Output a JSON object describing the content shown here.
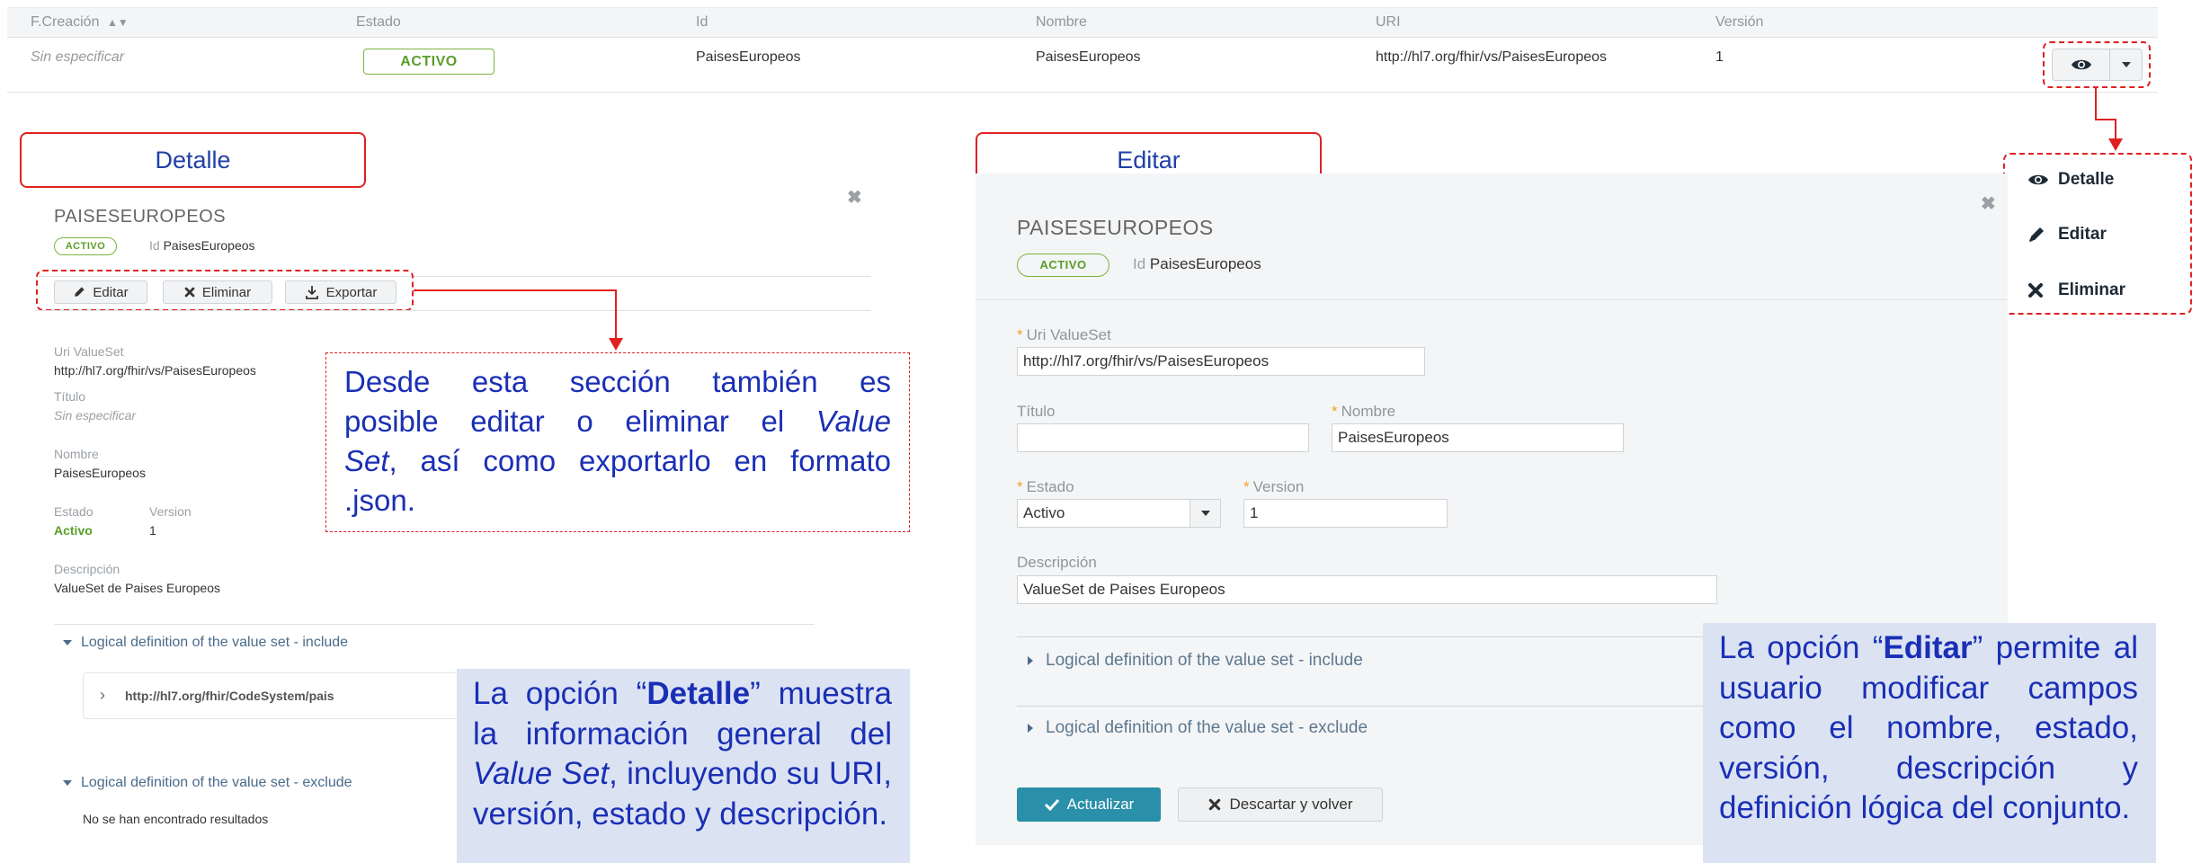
{
  "table": {
    "headers": {
      "fecha": "F.Creación",
      "fecha_sort_icon": "sort-icon",
      "estado": "Estado",
      "id": "Id",
      "nombre": "Nombre",
      "uri": "URI",
      "version": "Versión"
    },
    "row": {
      "fecha": "Sin especificar",
      "estado": "ACTIVO",
      "id": "PaisesEuropeos",
      "nombre": "PaisesEuropeos",
      "uri": "http://hl7.org/fhir/vs/PaisesEuropeos",
      "version": "1"
    },
    "actions": {
      "view_icon": "eye-icon",
      "caret_icon": "caret-down-icon"
    }
  },
  "dropdown_menu": {
    "items": [
      {
        "label": "Detalle",
        "icon": "eye-icon"
      },
      {
        "label": "Editar",
        "icon": "pencil-icon"
      },
      {
        "label": "Eliminar",
        "icon": "close-icon"
      }
    ]
  },
  "labels": {
    "detalle_title": "Detalle",
    "editar_title": "Editar"
  },
  "detail_panel": {
    "title": "PAISESEUROPEOS",
    "badge": "ACTIVO",
    "id_label": "Id",
    "id_value": "PaisesEuropeos",
    "buttons": {
      "editar": "Editar",
      "eliminar": "Eliminar",
      "exportar": "Exportar"
    },
    "uri_label": "Uri ValueSet",
    "uri_value": "http://hl7.org/fhir/vs/PaisesEuropeos",
    "titulo_label": "Título",
    "titulo_value": "Sin especificar",
    "nombre_label": "Nombre",
    "nombre_value": "PaisesEuropeos",
    "estado_label": "Estado",
    "estado_value": "Activo",
    "version_label": "Version",
    "version_value": "1",
    "descripcion_label": "Descripción",
    "descripcion_value": "ValueSet de Paises Europeos",
    "include_section": "Logical definition of the value set - include",
    "include_item": "http://hl7.org/fhir/CodeSystem/pais",
    "exclude_section": "Logical definition of the value set - exclude",
    "exclude_empty": "No se han encontrado resultados"
  },
  "callouts": {
    "section": {
      "line1": "Desde esta sección también es",
      "line2": "posible editar o eliminar el ",
      "line2_em": "Value",
      "line3_em": "Set",
      "line3": ", así como exportarlo en formato",
      "line4": ".json."
    },
    "detalle": {
      "p1": "La opción “",
      "p1_bold": "Detalle",
      "p2": "” muestra la información general del ",
      "p2_em": "Value Set",
      "p3": ", incluyendo su URI, versión, estado y descripción."
    },
    "editar": {
      "p1": "La opción “",
      "p1_bold": "Editar",
      "p2": "” permite al usuario modificar campos como el nombre, estado, versión, descripción y definición lógica del conjunto."
    }
  },
  "edit_panel": {
    "title": "PAISESEUROPEOS",
    "badge": "ACTIVO",
    "id_label": "Id",
    "id_value": "PaisesEuropeos",
    "uri_label": "Uri ValueSet",
    "uri_value": "http://hl7.org/fhir/vs/PaisesEuropeos",
    "titulo_label": "Título",
    "titulo_value": "",
    "nombre_label": "Nombre",
    "nombre_value": "PaisesEuropeos",
    "estado_label": "Estado",
    "estado_value": "Activo",
    "version_label": "Version",
    "version_value": "1",
    "descripcion_label": "Descripción",
    "descripcion_value": "ValueSet de Paises Europeos",
    "include_section": "Logical definition of the value set - include",
    "exclude_section": "Logical definition of the value set - exclude",
    "actualizar": "Actualizar",
    "descartar": "Descartar y volver"
  },
  "colors": {
    "annotation_red": "#e02020",
    "annotation_blue_text": "#1a2fb5",
    "callout_bg": "#dbe3f3",
    "status_green": "#5a9e2a",
    "primary_button": "#2a8fa8"
  }
}
